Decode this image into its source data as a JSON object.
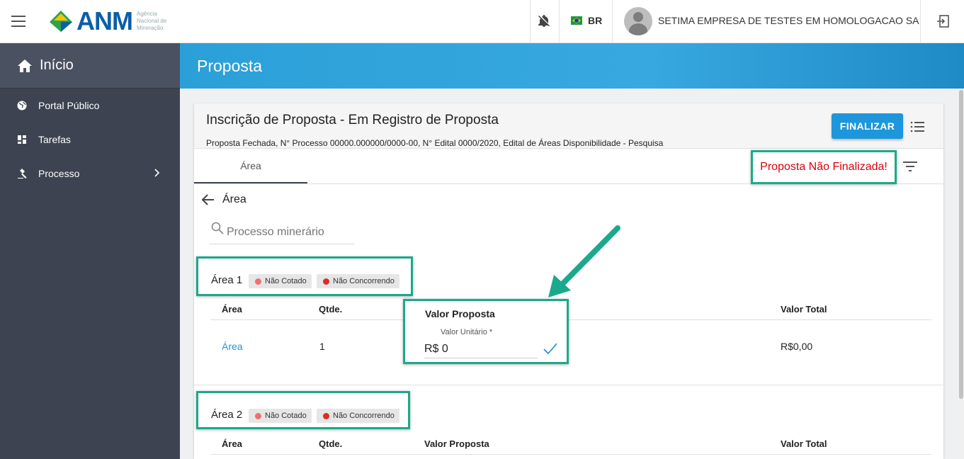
{
  "header": {
    "logo_text": "ANM",
    "logo_sub": "Agência Nacional de Mineração",
    "language": "BR",
    "company": "SETIMA EMPRESA DE TESTES EM HOMOLOGACAO SA"
  },
  "sidebar": {
    "home_label": "Início",
    "items": [
      {
        "label": "Portal Público",
        "icon": "globe-icon"
      },
      {
        "label": "Tarefas",
        "icon": "dashboard-icon"
      },
      {
        "label": "Processo",
        "icon": "gavel-icon"
      }
    ]
  },
  "banner": {
    "title": "Proposta"
  },
  "card": {
    "title": "Inscrição de Proposta - Em Registro de Proposta",
    "subtitle": "Proposta Fechada, N° Processo 00000.000000/0000-00, N° Edital 0000/2020, Edital de Áreas Disponibilidade - Pesquisa",
    "finalize_label": "FINALIZAR",
    "tab_label": "Área",
    "status": "Proposta Não Finalizada!",
    "back_label": "Área",
    "search_placeholder": "Processo minerário"
  },
  "colors": {
    "accent": "#1e96db",
    "highlight": "#1ba98b",
    "error": "#d9000d",
    "sidebar": "#3d4350"
  },
  "areas": [
    {
      "name": "Área 1",
      "chips": [
        {
          "label": "Não Cotado",
          "color": "#f07070"
        },
        {
          "label": "Não Concorrendo",
          "color": "#e02b2b"
        }
      ],
      "columns": [
        "Área",
        "Qtde.",
        "Valor Proposta",
        "Valor Total"
      ],
      "row": {
        "area": "Área",
        "qtde": "1",
        "unit_label": "Valor Unitário *",
        "unit_value": "R$ 0",
        "total": "R$0,00"
      }
    },
    {
      "name": "Área 2",
      "chips": [
        {
          "label": "Não Cotado",
          "color": "#f07070"
        },
        {
          "label": "Não Concorrendo",
          "color": "#e02b2b"
        }
      ],
      "columns": [
        "Área",
        "Qtde.",
        "Valor Proposta",
        "Valor Total"
      ]
    }
  ]
}
